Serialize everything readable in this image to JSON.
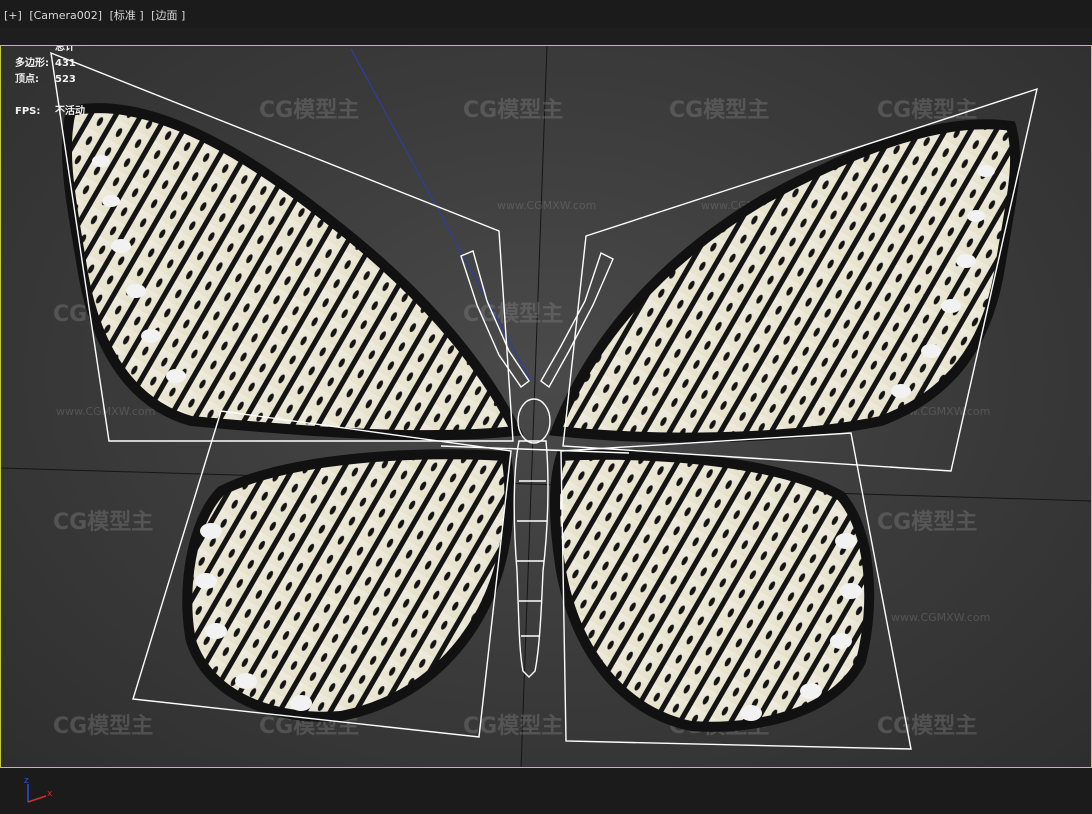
{
  "viewport_label": {
    "plus": "[+]",
    "camera": "[Camera002]",
    "shading": "[标准 ]",
    "mode": "[边面 ]"
  },
  "stats": {
    "header": "总计",
    "polys_label": "多边形:",
    "polys_value": "431",
    "verts_label": "顶点:",
    "verts_value": "523",
    "fps_label": "FPS:",
    "fps_value": "不活动"
  },
  "watermark": {
    "logo": "CG模型主",
    "url": "www.CGMXW.com"
  },
  "axis_gizmo": {
    "z": "z",
    "x": "x"
  },
  "colors": {
    "viewport_border": "#c8c832",
    "wireframe": "#ffffff",
    "camera_line": "#2e3ea0",
    "axis_x": "#d03030",
    "axis_z": "#3050d0"
  }
}
